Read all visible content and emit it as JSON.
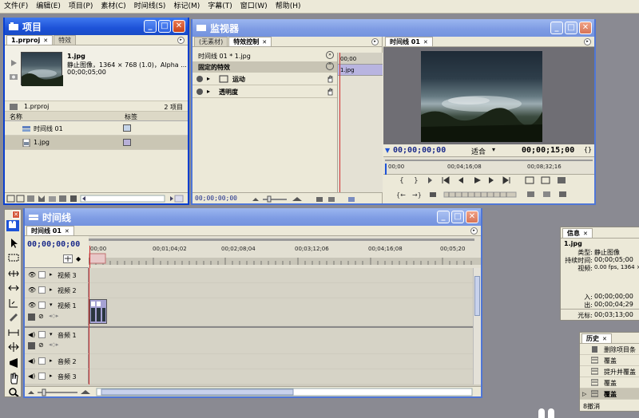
{
  "menu": [
    "文件(F)",
    "编辑(E)",
    "项目(P)",
    "素材(C)",
    "时间线(S)",
    "标记(M)",
    "字幕(T)",
    "窗口(W)",
    "帮助(H)"
  ],
  "project": {
    "title": "项目",
    "tabs": [
      "1.prproj",
      "特效"
    ],
    "clip": {
      "name": "1.jpg",
      "line1": "静止图像，1364 × 768 (1.0)，Alpha ...",
      "line2": "00;00;05;00"
    },
    "file": "1.prproj",
    "count": "2 项目",
    "col_name": "名称",
    "col_label": "标签",
    "items": [
      {
        "name": "时间线 01",
        "color": "#c5d4e8"
      },
      {
        "name": "1.jpg",
        "color": "#b8b0d8"
      }
    ]
  },
  "monitor": {
    "title": "监视器",
    "tabs": [
      "(无素材)",
      "特效控制"
    ],
    "seq_row": "时间线 01 * 1.jpg",
    "fixed": "固定的特效",
    "effects": [
      "运动",
      "透明度"
    ],
    "mini_tc": "00;00",
    "mini_clip": "1.jpg",
    "bottom_tc": "00;00;00;00",
    "prog_tab": "时间线 01",
    "tc_left": "00;00;00;00",
    "fit": "适合",
    "tc_right": "00;00;15;00",
    "ruler": [
      "00;00",
      "00;04;16;08",
      "00;08;32;16"
    ]
  },
  "timeline": {
    "title": "时间线",
    "tab": "时间线 01",
    "tc": "00;00;00;00",
    "ruler": [
      "00;00",
      "00;01;04;02",
      "00;02;08;04",
      "00;03;12;06",
      "00;04;16;08",
      "00;05;20"
    ],
    "tracks": [
      "视频 3",
      "视频 2",
      "视频 1",
      "音频 1",
      "音频 2",
      "音频 3"
    ]
  },
  "info": {
    "tab": "信息",
    "name": "1.jpg",
    "rows": [
      {
        "k": "类型:",
        "v": "静止图像"
      },
      {
        "k": "持续时间:",
        "v": "00;00;05;00"
      },
      {
        "k": "视频:",
        "v": "0.00 fps, 1364 ×"
      },
      {
        "k": "入:",
        "v": "00;00;00;00"
      },
      {
        "k": "出:",
        "v": "00;00;04;29"
      },
      {
        "k": "光标:",
        "v": "00;03;13;00"
      }
    ]
  },
  "history": {
    "tab": "历史",
    "items": [
      "删除项目条",
      "覆盖",
      "提升并覆盖",
      "覆盖",
      "覆盖"
    ],
    "undo": "8撤消"
  },
  "colors": {
    "title_active": "#1d52d8",
    "playhead": "#d23030",
    "panel": "#ece9d8"
  }
}
